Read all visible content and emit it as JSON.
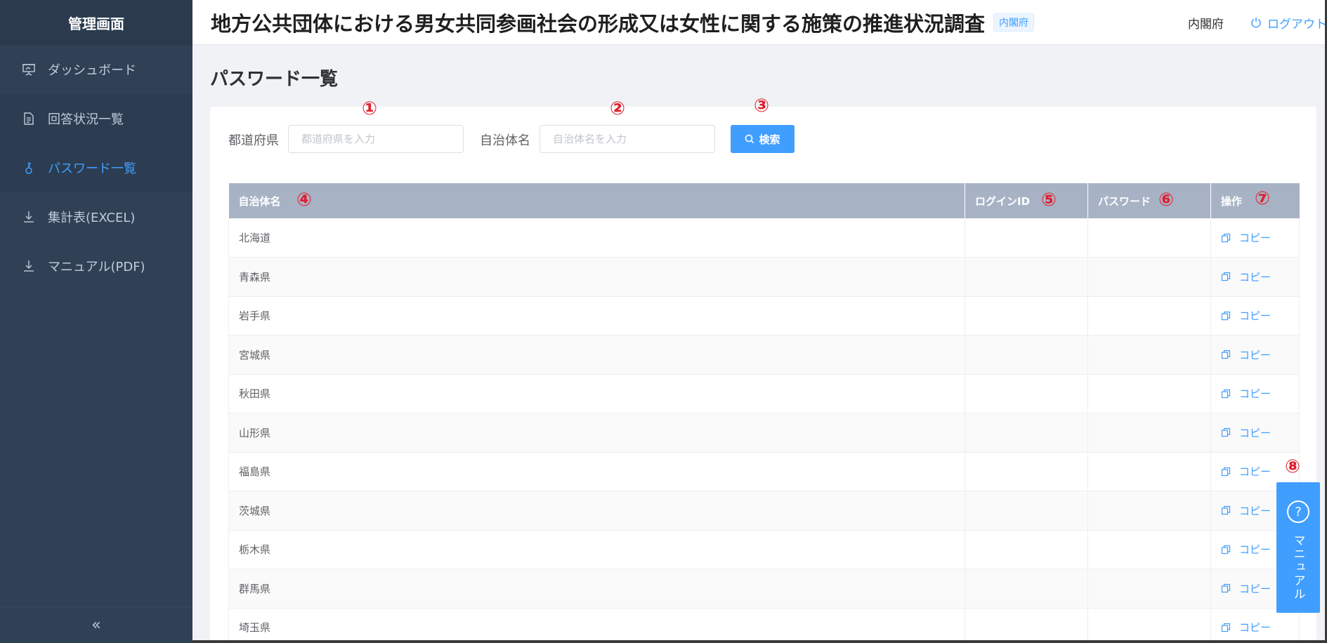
{
  "sidebar": {
    "title": "管理画面",
    "items": [
      {
        "label": "ダッシュボード",
        "icon": "presentation-icon"
      },
      {
        "label": "回答状況一覧",
        "icon": "document-icon"
      },
      {
        "label": "パスワード一覧",
        "icon": "key-icon",
        "active": true
      },
      {
        "label": "集計表(EXCEL)",
        "icon": "download-icon"
      },
      {
        "label": "マニュアル(PDF)",
        "icon": "download-icon"
      }
    ],
    "collapse_glyph": "«"
  },
  "header": {
    "title": "地方公共団体における男女共同参画社会の形成又は女性に関する施策の推進状況調査",
    "badge": "内閣府",
    "org_name": "内閣府",
    "logout_label": "ログアウト"
  },
  "main": {
    "page_title": "パスワード一覧",
    "filters": {
      "prefecture_label": "都道府県",
      "prefecture_placeholder": "都道府県を入力",
      "municipality_label": "自治体名",
      "municipality_placeholder": "自治体名を入力",
      "search_label": "検索"
    },
    "table": {
      "columns": [
        "自治体名",
        "ログインID",
        "パスワード",
        "操作"
      ],
      "rows": [
        {
          "name": "北海道",
          "login_id": "",
          "password": ""
        },
        {
          "name": "青森県",
          "login_id": "",
          "password": ""
        },
        {
          "name": "岩手県",
          "login_id": "",
          "password": ""
        },
        {
          "name": "宮城県",
          "login_id": "",
          "password": ""
        },
        {
          "name": "秋田県",
          "login_id": "",
          "password": ""
        },
        {
          "name": "山形県",
          "login_id": "",
          "password": ""
        },
        {
          "name": "福島県",
          "login_id": "",
          "password": ""
        },
        {
          "name": "茨城県",
          "login_id": "",
          "password": ""
        },
        {
          "name": "栃木県",
          "login_id": "",
          "password": ""
        },
        {
          "name": "群馬県",
          "login_id": "",
          "password": ""
        },
        {
          "name": "埼玉県",
          "login_id": "",
          "password": ""
        }
      ],
      "action_label": "コピー"
    }
  },
  "annotations": [
    "①",
    "②",
    "③",
    "④",
    "⑤",
    "⑥",
    "⑦",
    "⑧"
  ],
  "manual_button": {
    "label": "マニュアル",
    "icon_glyph": "?"
  },
  "colors": {
    "sidebar_bg": "#304156",
    "accent": "#409eff",
    "table_header_bg": "#a7b3c5",
    "annotation": "#e0202e"
  }
}
